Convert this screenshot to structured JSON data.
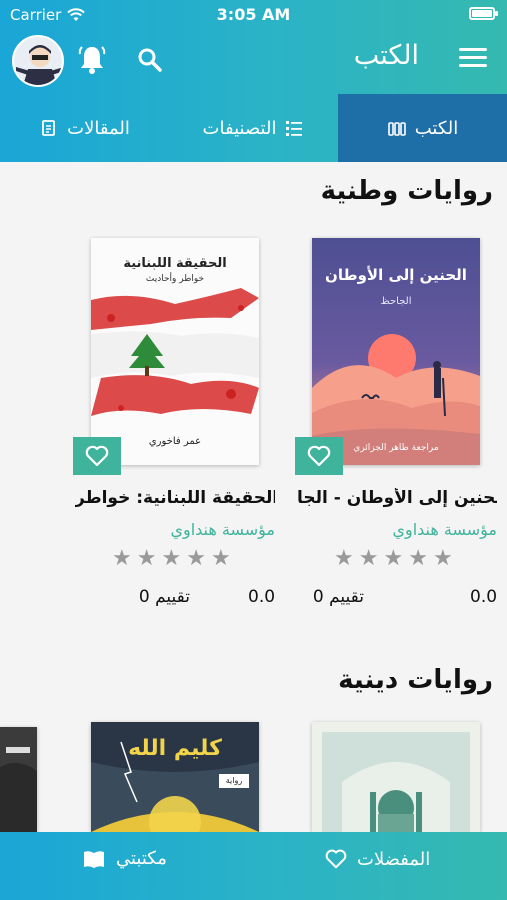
{
  "status_bar": {
    "carrier": "Carrier",
    "time": "3:05 AM"
  },
  "nav": {
    "title": "الكتب",
    "icons": [
      "menu-icon",
      "search-icon",
      "bell-icon",
      "avatar"
    ]
  },
  "tabs": [
    {
      "label": "الكتب",
      "icon": "books-icon",
      "active": true
    },
    {
      "label": "التصنيفات",
      "icon": "list-icon",
      "active": false
    },
    {
      "label": "المقالات",
      "icon": "document-icon",
      "active": false
    }
  ],
  "sections": [
    {
      "title": "روايات وطنية",
      "books": [
        {
          "title": "الحنين إلى الأوطان - الجا...",
          "publisher": "مؤسسة هنداوي",
          "score": "0.0",
          "ratings": "0 تقييم",
          "stars": 0,
          "cover_title": "الحنين إلى الأوطان",
          "cover_author": "الجاحظ",
          "cover_footer": "مراجعة طاهر الجزائري"
        },
        {
          "title": "الحقيقة اللبنانية: خواطر ...",
          "publisher": "مؤسسة هنداوي",
          "score": "0.0",
          "ratings": "0 تقييم",
          "stars": 0,
          "cover_title": "الحقيقة اللبنانية",
          "cover_author": "خواطر وأحاديث",
          "cover_footer": "عمر فاخوري"
        }
      ]
    },
    {
      "title": "روايات دينية",
      "books": [
        {
          "cover_title": ""
        },
        {
          "cover_title": "كليم الله",
          "cover_badge": "رواية"
        }
      ]
    }
  ],
  "bottom_nav": [
    {
      "label": "المفضلات",
      "icon": "heart-icon"
    },
    {
      "label": "مكتبتي",
      "icon": "open-book-icon"
    }
  ],
  "colors": {
    "header_start": "#1aa6d6",
    "header_end": "#35b9b0",
    "active_tab": "#1e6ea8",
    "accent_green": "#3fb39b",
    "star_gray": "#9a9a9a"
  }
}
